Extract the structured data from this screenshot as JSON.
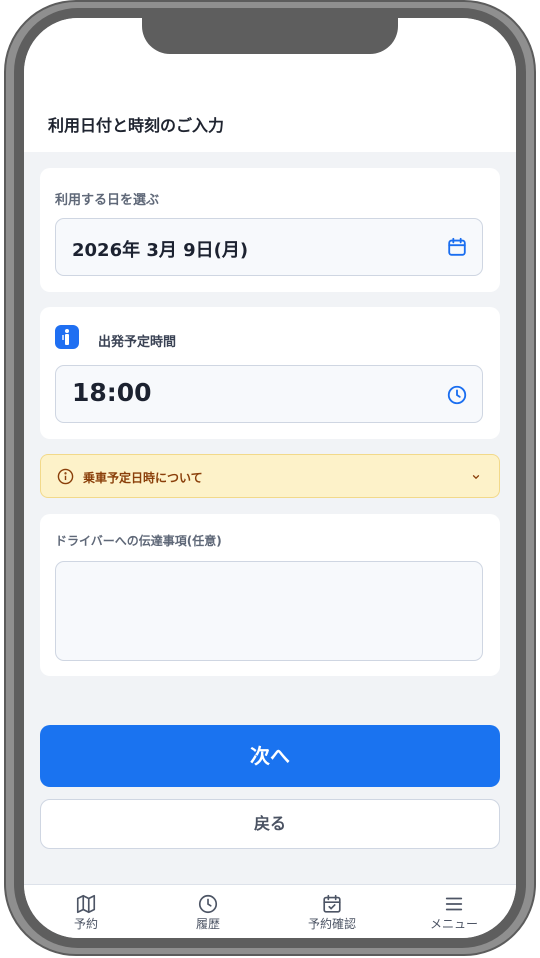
{
  "header": {
    "title": "利用日付と時刻のご入力"
  },
  "date_section": {
    "label": "利用する日を選ぶ",
    "value": "2026年 3月 9日(月)",
    "icon": "calendar-icon"
  },
  "time_section": {
    "label": "出発予定時間",
    "value": "18:00",
    "icon": "clock-icon",
    "badge_icon": "person-standing-icon"
  },
  "notice": {
    "text": "乗車予定日時について",
    "icon": "info-icon",
    "expand_icon": "chevron-down-icon"
  },
  "memo_section": {
    "label": "ドライバーへの伝達事項(任意)",
    "value": ""
  },
  "buttons": {
    "next": "次へ",
    "back": "戻る"
  },
  "bottom_nav": {
    "items": [
      {
        "label": "予約",
        "icon": "map-icon"
      },
      {
        "label": "履歴",
        "icon": "clock-icon"
      },
      {
        "label": "予約確認",
        "icon": "calendar-check-icon"
      },
      {
        "label": "メニュー",
        "icon": "menu-icon"
      }
    ]
  },
  "colors": {
    "accent": "#1a73f0",
    "notice_bg": "#fdf2c9",
    "notice_text": "#8a3f0a",
    "background": "#f1f3f6"
  }
}
